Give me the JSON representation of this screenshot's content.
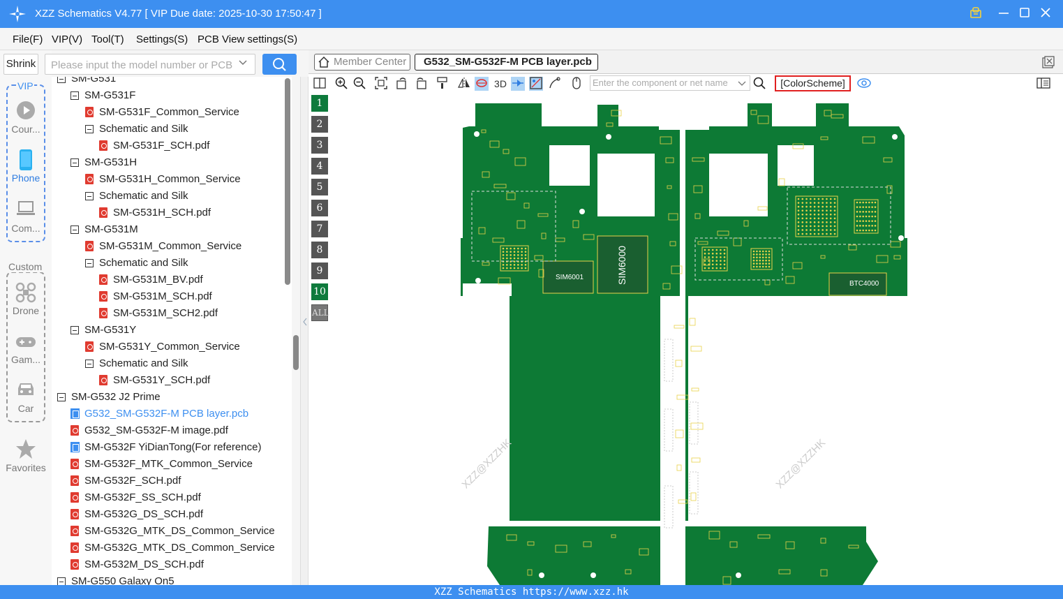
{
  "title": "XZZ Schematics V4.77 [ VIP Due date: 2025-10-30 17:50:47 ]",
  "menu": [
    "File(F)",
    "VIP(V)",
    "Tool(T)",
    "Settings(S)",
    "PCB View settings(S)"
  ],
  "shrink_label": "Shrink",
  "search": {
    "placeholder": "Please input the model number or PCB"
  },
  "rail": {
    "vip_label": "VIP",
    "courses": "Cour...",
    "phone": "Phone",
    "computer": "Com...",
    "custom_label": "Custom",
    "drone": "Drone",
    "game": "Gam...",
    "car": "Car",
    "favorites": "Favorites"
  },
  "tree": [
    {
      "label": "SM-G531",
      "type": "folder",
      "level": 0
    },
    {
      "label": "SM-G531F",
      "type": "folder",
      "level": 1
    },
    {
      "label": "SM-G531F_Common_Service",
      "type": "pdf",
      "level": 2
    },
    {
      "label": "Schematic and Silk",
      "type": "folder",
      "level": 2
    },
    {
      "label": "SM-G531F_SCH.pdf",
      "type": "pdf",
      "level": 3
    },
    {
      "label": "SM-G531H",
      "type": "folder",
      "level": 1
    },
    {
      "label": "SM-G531H_Common_Service",
      "type": "pdf",
      "level": 2
    },
    {
      "label": "Schematic and Silk",
      "type": "folder",
      "level": 2
    },
    {
      "label": "SM-G531H_SCH.pdf",
      "type": "pdf",
      "level": 3
    },
    {
      "label": "SM-G531M",
      "type": "folder",
      "level": 1
    },
    {
      "label": "SM-G531M_Common_Service",
      "type": "pdf",
      "level": 2
    },
    {
      "label": "Schematic and Silk",
      "type": "folder",
      "level": 2
    },
    {
      "label": "SM-G531M_BV.pdf",
      "type": "pdf",
      "level": 3
    },
    {
      "label": "SM-G531M_SCH.pdf",
      "type": "pdf",
      "level": 3
    },
    {
      "label": "SM-G531M_SCH2.pdf",
      "type": "pdf",
      "level": 3
    },
    {
      "label": "SM-G531Y",
      "type": "folder",
      "level": 1
    },
    {
      "label": "SM-G531Y_Common_Service",
      "type": "pdf",
      "level": 2
    },
    {
      "label": "Schematic and Silk",
      "type": "folder",
      "level": 2
    },
    {
      "label": "SM-G531Y_SCH.pdf",
      "type": "pdf",
      "level": 3
    },
    {
      "label": "SM-G532 J2 Prime",
      "type": "folder",
      "level": 0
    },
    {
      "label": "G532_SM-G532F-M PCB layer.pcb",
      "type": "pcb",
      "level": 1,
      "selected": true
    },
    {
      "label": "G532_SM-G532F-M image.pdf",
      "type": "pdf",
      "level": 1
    },
    {
      "label": "SM-G532F YiDianTong(For reference)",
      "type": "pcb",
      "level": 1
    },
    {
      "label": "SM-G532F_MTK_Common_Service",
      "type": "pdf",
      "level": 1
    },
    {
      "label": "SM-G532F_SCH.pdf",
      "type": "pdf",
      "level": 1
    },
    {
      "label": "SM-G532F_SS_SCH.pdf",
      "type": "pdf",
      "level": 1
    },
    {
      "label": "SM-G532G_DS_SCH.pdf",
      "type": "pdf",
      "level": 1
    },
    {
      "label": "SM-G532G_MTK_DS_Common_Service",
      "type": "pdf",
      "level": 1
    },
    {
      "label": "SM-G532G_MTK_DS_Common_Service",
      "type": "pdf",
      "level": 1
    },
    {
      "label": "SM-G532M_DS_SCH.pdf",
      "type": "pdf",
      "level": 1
    },
    {
      "label": "SM-G550 Galaxy On5",
      "type": "folder",
      "level": 0
    }
  ],
  "tabs": {
    "member": "Member Center",
    "active": "G532_SM-G532F-M PCB layer.pcb"
  },
  "toolbar": {
    "label_3d": "3D",
    "component_placeholder": "Enter the component or net name",
    "color_scheme": "[ColorScheme]"
  },
  "layers": [
    "1",
    "2",
    "3",
    "4",
    "5",
    "6",
    "7",
    "8",
    "9",
    "10",
    "ALL"
  ],
  "board": {
    "sim6001": "SIM6001",
    "sim6000": "SIM6000",
    "btc4000": "BTC4000",
    "watermark": "XZZ@XZZHK",
    "board_color": "#0d7a35",
    "chip_color": "#e8d24a"
  },
  "status": "XZZ Schematics https://www.xzz.hk"
}
